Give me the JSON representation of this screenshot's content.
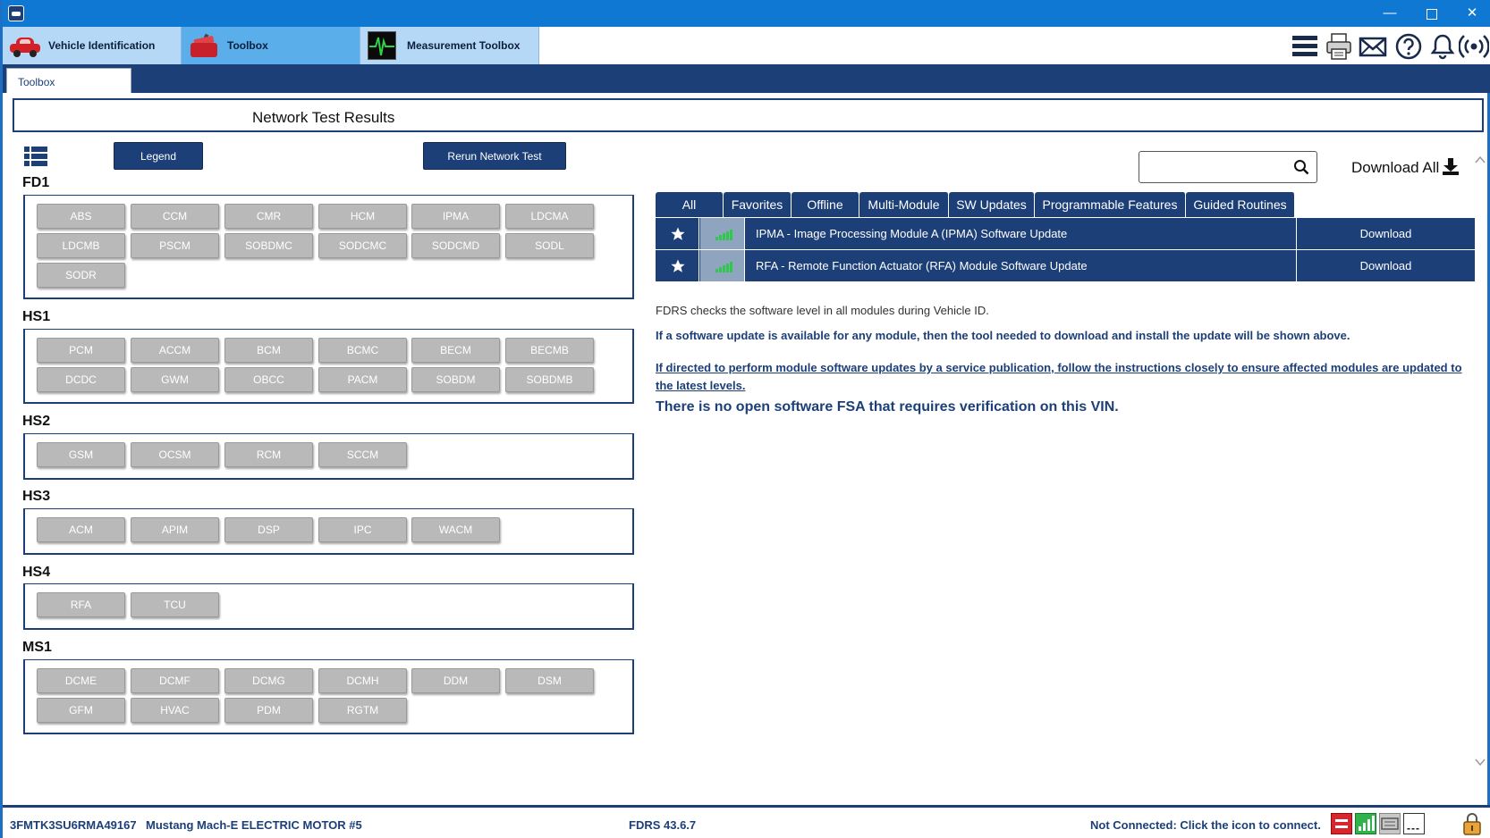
{
  "window": {
    "minimize": "—",
    "close": "✕"
  },
  "main_tabs": [
    {
      "label": "Vehicle Identification"
    },
    {
      "label": "Toolbox"
    },
    {
      "label": "Measurement Toolbox"
    }
  ],
  "sub_tab": {
    "label": "Toolbox"
  },
  "page_title": "Network Test Results",
  "toolbar": {
    "legend_label": "Legend",
    "rerun_label": "Rerun Network Test"
  },
  "groups": [
    {
      "name": "FD1",
      "modules": [
        "ABS",
        "CCM",
        "CMR",
        "HCM",
        "IPMA",
        "LDCMA",
        "LDCMB",
        "PSCM",
        "SOBDMC",
        "SODCMC",
        "SODCMD",
        "SODL",
        "SODR"
      ]
    },
    {
      "name": "HS1",
      "modules": [
        "PCM",
        "ACCM",
        "BCM",
        "BCMC",
        "BECM",
        "BECMB",
        "DCDC",
        "GWM",
        "OBCC",
        "PACM",
        "SOBDM",
        "SOBDMB"
      ]
    },
    {
      "name": "HS2",
      "modules": [
        "GSM",
        "OCSM",
        "RCM",
        "SCCM"
      ]
    },
    {
      "name": "HS3",
      "modules": [
        "ACM",
        "APIM",
        "DSP",
        "IPC",
        "WACM"
      ]
    },
    {
      "name": "HS4",
      "modules": [
        "RFA",
        "TCU"
      ]
    },
    {
      "name": "MS1",
      "modules": [
        "DCME",
        "DCMF",
        "DCMG",
        "DCMH",
        "DDM",
        "DSM",
        "GFM",
        "HVAC",
        "PDM",
        "RGTM"
      ]
    }
  ],
  "search": {
    "placeholder": ""
  },
  "download_all": "Download All",
  "filter_tabs": [
    "All",
    "Favorites",
    "Offline",
    "Multi-Module",
    "SW Updates",
    "Programmable Features",
    "Guided Routines"
  ],
  "updates": [
    {
      "name": "IPMA - Image Processing Module A (IPMA) Software Update",
      "action": "Download"
    },
    {
      "name": "RFA - Remote Function Actuator (RFA) Module Software Update",
      "action": "Download"
    }
  ],
  "info": {
    "line1": "FDRS checks the software level in all modules during Vehicle ID.",
    "line2": "If a software update is available for any module, then the tool needed to download and install the update will be shown above.",
    "line3": "If directed to perform module software updates by a service publication, follow the instructions closely to ensure affected modules are updated to the latest levels.",
    "line4": "There is no open software FSA that requires verification on this VIN."
  },
  "status": {
    "vin": "3FMTK3SU6RMA49167",
    "model": "Mustang Mach-E ELECTRIC MOTOR #5",
    "version": "FDRS 43.6.7",
    "connection": "Not Connected: Click the icon to connect.",
    "dashes": "---"
  },
  "colors": {
    "brand_navy": "#1c3f78",
    "titlebar_blue": "#0f78d2",
    "tab_active": "#5aaeea",
    "tab_inactive": "#b4d8f6",
    "module_gray": "#b9b9b9",
    "signal_green": "#2fc94a"
  }
}
